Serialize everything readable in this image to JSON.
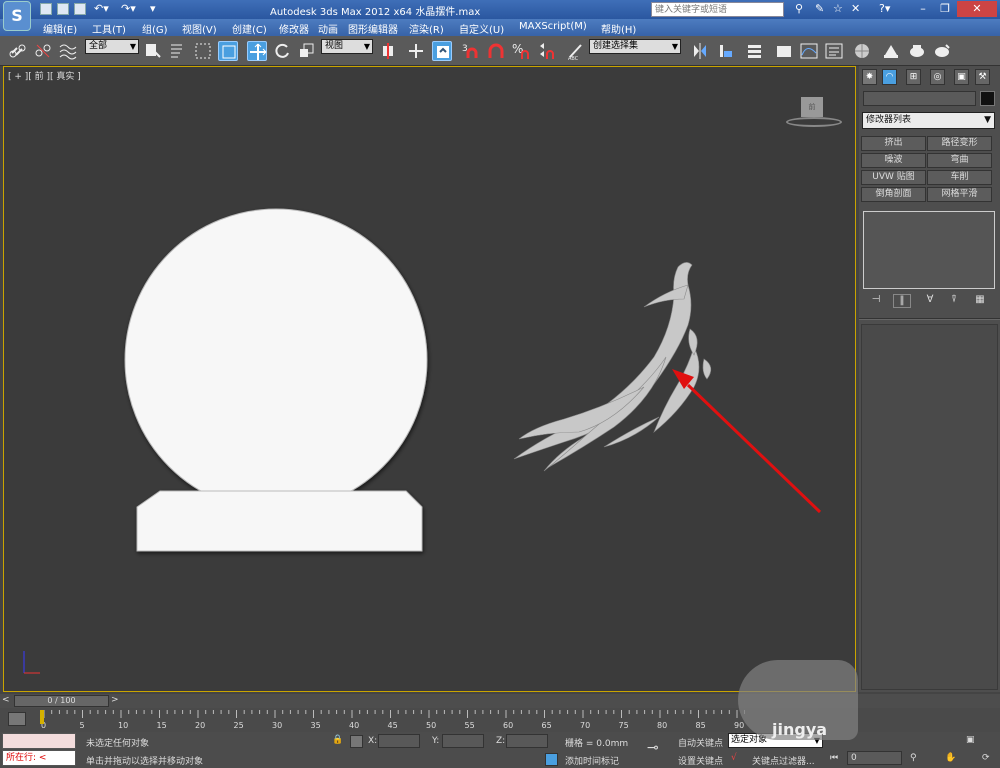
{
  "title_bar": {
    "app_title": "Autodesk 3ds Max  2012 x64",
    "file_name": "水晶摆件.max",
    "search_placeholder": "键入关键字或短语"
  },
  "menu": {
    "items": [
      "编辑(E)",
      "工具(T)",
      "组(G)",
      "视图(V)",
      "创建(C)",
      "修改器",
      "动画",
      "图形编辑器",
      "渲染(R)",
      "自定义(U)",
      "MAXScript(M)",
      "帮助(H)"
    ]
  },
  "toolbar": {
    "selection_filter": "全部",
    "reference_coord": "视图",
    "named_selection": "创建选择集",
    "snap_angle_label": "3"
  },
  "viewport": {
    "label": "[ + ][ 前 ][ 真实 ]",
    "viewcube_label": "前"
  },
  "command_panel": {
    "modifier_list": "修改器列表",
    "modifier_buttons": [
      "挤出",
      "路径变形",
      "噪波",
      "弯曲",
      "UVW 贴图",
      "车削",
      "倒角剖面",
      "网格平滑"
    ]
  },
  "time_slider": {
    "frame_display": "0 / 100",
    "left_arrow": "<",
    "right_arrow": ">"
  },
  "track_bar": {
    "ticks": [
      "0",
      "5",
      "10",
      "15",
      "20",
      "25",
      "30",
      "35",
      "40",
      "45",
      "50",
      "55",
      "60",
      "65",
      "70",
      "75",
      "80",
      "85",
      "90"
    ]
  },
  "status_bar": {
    "status_line1": "未选定任何对象",
    "status_line2": "单击并拖动以选择并移动对象",
    "x_label": "X:",
    "y_label": "Y:",
    "z_label": "Z:",
    "grid": "栅格 = 0.0mm",
    "add_time_tag": "添加时间标记",
    "auto_key": "自动关键点",
    "set_key": "设置关键点",
    "selected_object": "选定对象",
    "key_filters": "关键点过滤器...",
    "current_frame": "0",
    "listener_text": "所在行:"
  },
  "watermark": "jingya",
  "colors": {
    "viewport_border": "#c9a400",
    "annotation_arrow": "#e01010",
    "active_tool": "#4a9fe0"
  }
}
